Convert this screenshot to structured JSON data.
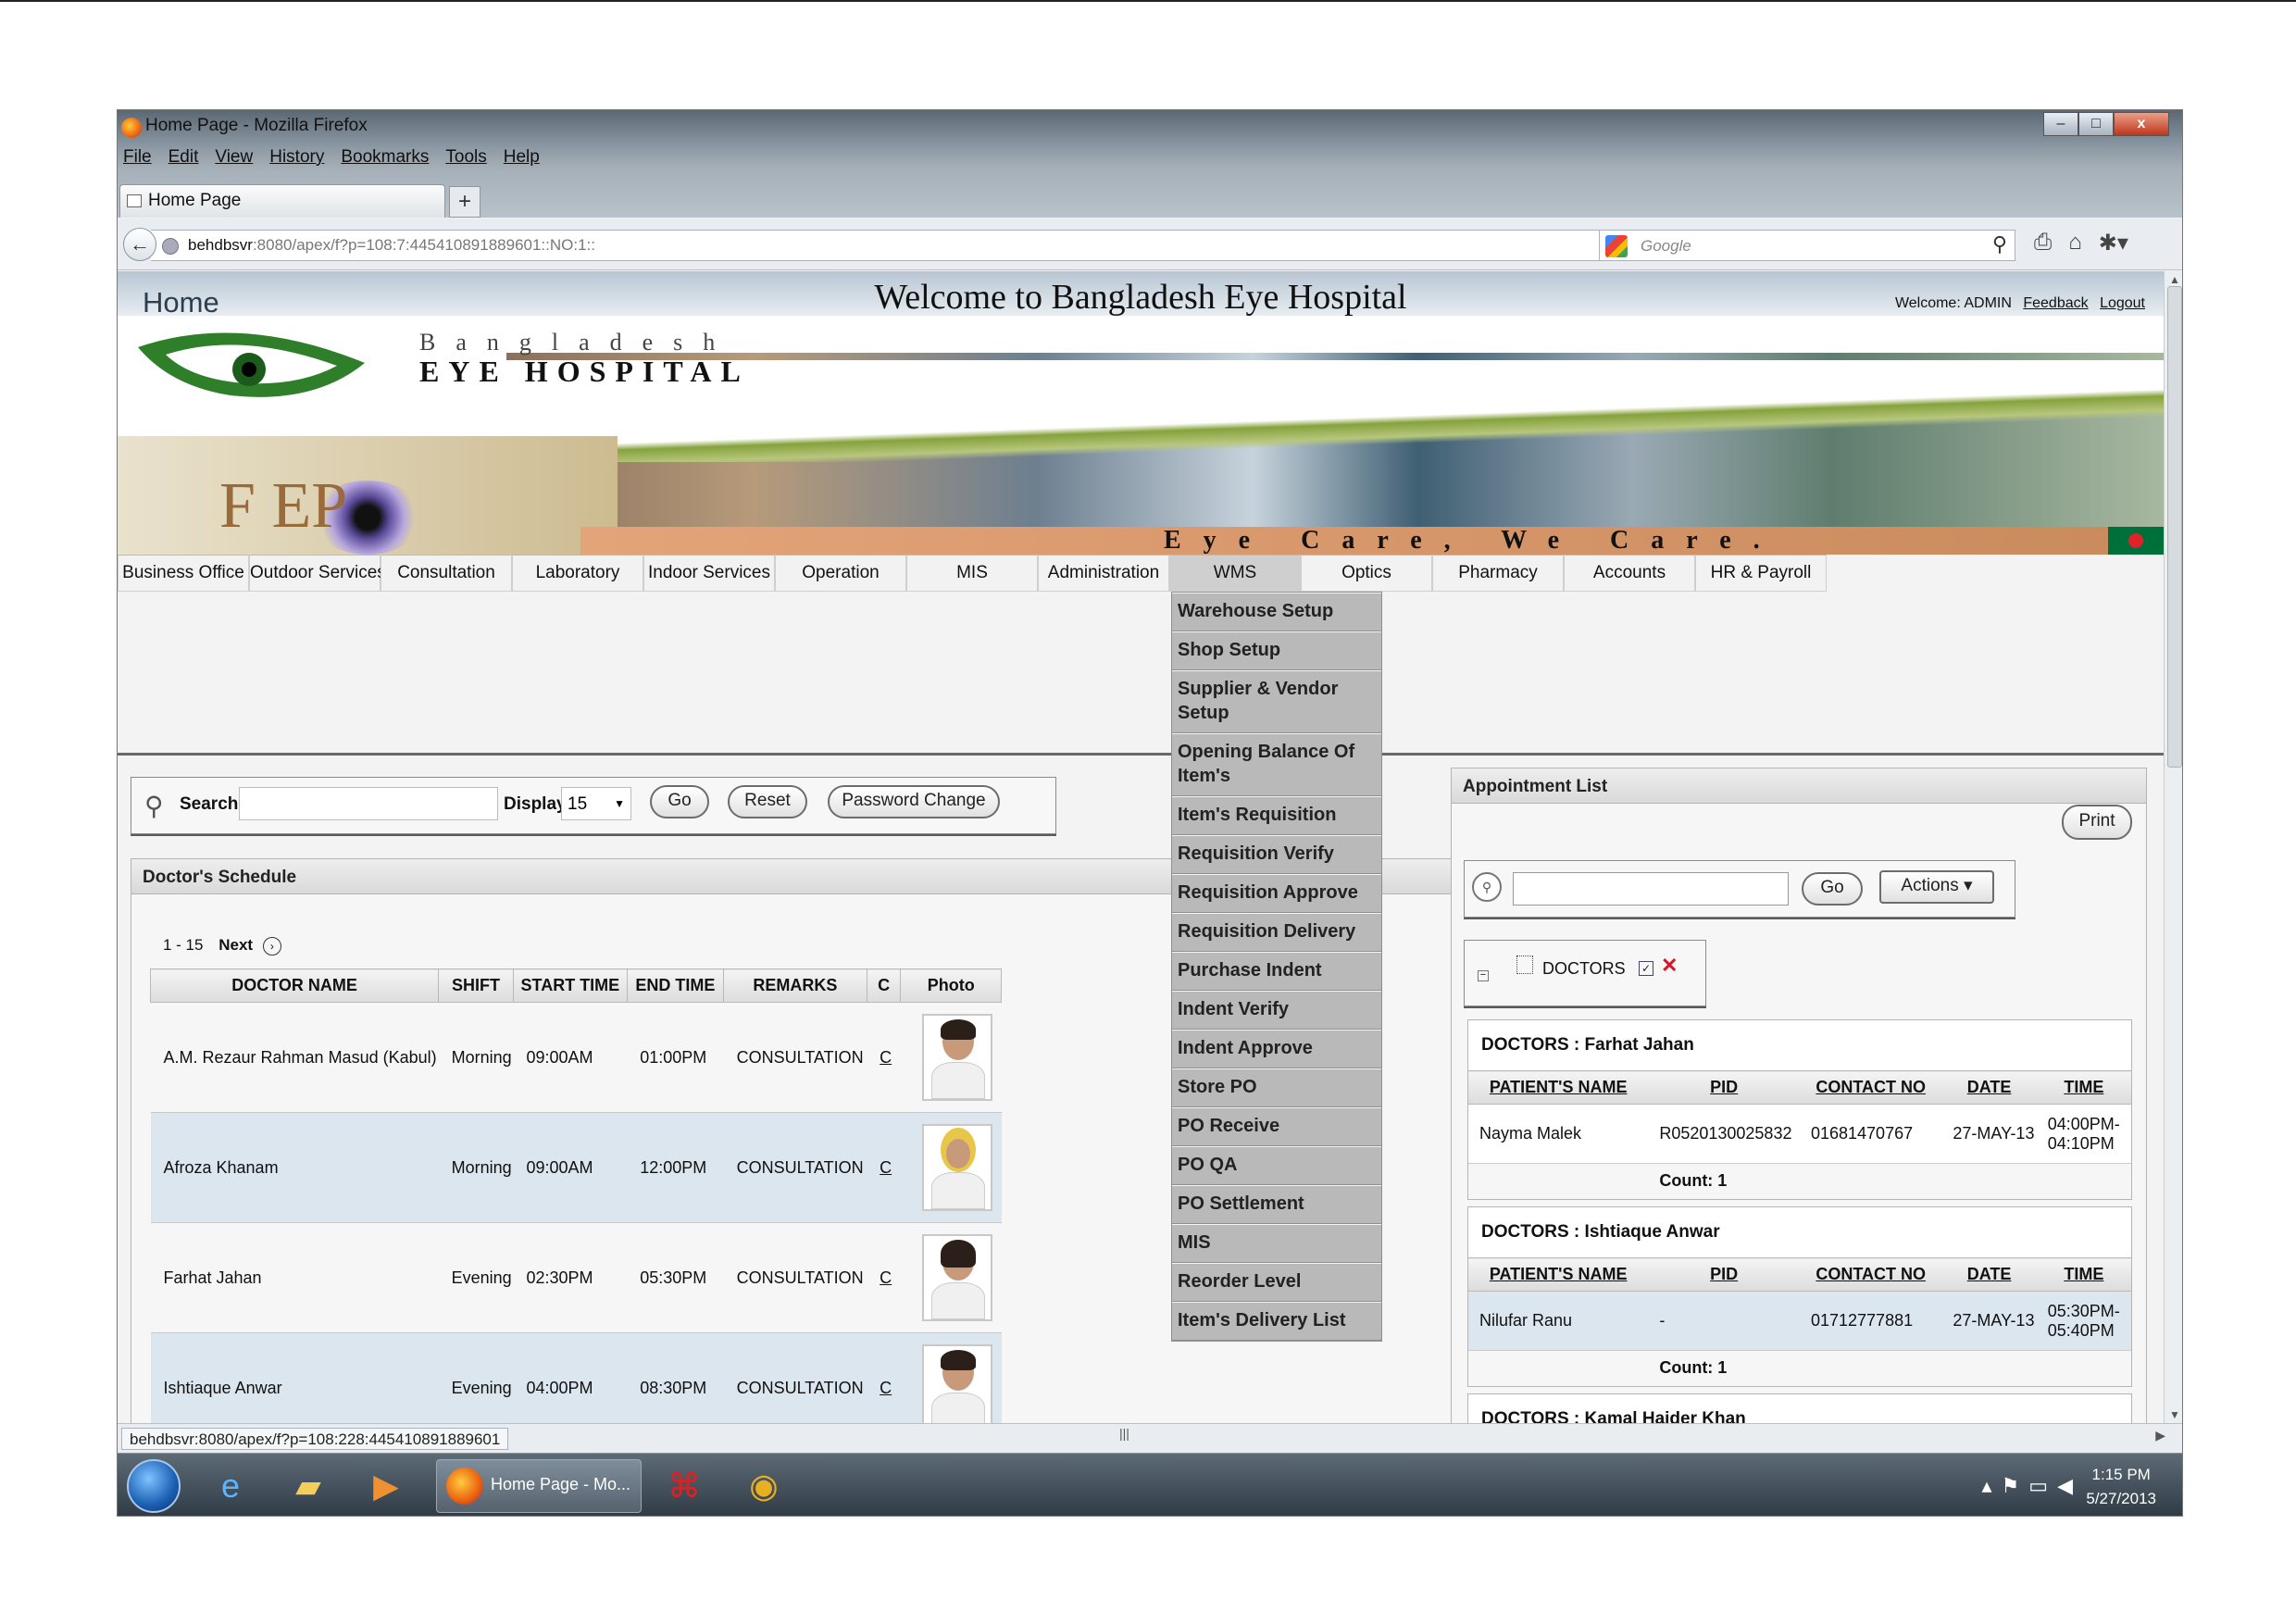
{
  "window": {
    "title": "Home Page - Mozilla Firefox",
    "controls": {
      "minimize": "–",
      "maximize": "□",
      "close": "x"
    }
  },
  "menu": [
    "File",
    "Edit",
    "View",
    "History",
    "Bookmarks",
    "Tools",
    "Help"
  ],
  "tab": {
    "label": "Home Page",
    "new_tab": "+"
  },
  "address": {
    "host": "behdbsvr",
    "path": ":8080/apex/f?p=108:7:445410891889601::NO:1::"
  },
  "search_engine": {
    "placeholder": "Google"
  },
  "page": {
    "heading": "Home",
    "welcome": "Welcome to Bangladesh Eye Hospital",
    "welcome_user": "Welcome: ADMIN",
    "feedback": "Feedback",
    "logout": "Logout"
  },
  "banner": {
    "line1": "Bangladesh",
    "line2": "EYE HOSPITAL",
    "tagline": "Eye Care, We Care.",
    "mark": "EP",
    "mark_f": "F"
  },
  "nav": [
    {
      "label": "Business Office"
    },
    {
      "label": "Outdoor Services"
    },
    {
      "label": "Consultation"
    },
    {
      "label": "Laboratory"
    },
    {
      "label": "Indoor Services"
    },
    {
      "label": "Operation"
    },
    {
      "label": "MIS"
    },
    {
      "label": "Administration"
    },
    {
      "label": "WMS",
      "active": true
    },
    {
      "label": "Optics"
    },
    {
      "label": "Pharmacy"
    },
    {
      "label": "Accounts"
    },
    {
      "label": "HR & Payroll"
    }
  ],
  "wms_menu": [
    "Warehouse Setup",
    "Shop Setup",
    "Supplier & Vendor Setup",
    "Opening Balance Of Item's",
    "Item's Requisition",
    "Requisition Verify",
    "Requisition Approve",
    "Requisition Delivery",
    "Purchase Indent",
    "Indent Verify",
    "Indent Approve",
    "Store PO",
    "PO Receive",
    "PO QA",
    "PO Settlement",
    "MIS",
    "Reorder Level",
    "Item's Delivery List"
  ],
  "search": {
    "label": "Search",
    "value": "",
    "display_label": "Display",
    "display_value": "15",
    "go": "Go",
    "reset": "Reset",
    "password_change": "Password Change"
  },
  "schedule": {
    "title": "Doctor's Schedule",
    "pager_range": "1 - 15",
    "pager_next": "Next",
    "columns": [
      "DOCTOR NAME",
      "SHIFT",
      "START TIME",
      "END TIME",
      "REMARKS",
      "C",
      "Photo"
    ],
    "rows": [
      {
        "name": "A.M. Rezaur Rahman Masud (Kabul)",
        "shift": "Morning",
        "start": "09:00AM",
        "end": "01:00PM",
        "remarks": "CONSULTATION",
        "c": "C"
      },
      {
        "name": "Afroza Khanam",
        "shift": "Morning",
        "start": "09:00AM",
        "end": "12:00PM",
        "remarks": "CONSULTATION",
        "c": "C"
      },
      {
        "name": "Farhat Jahan",
        "shift": "Evening",
        "start": "02:30PM",
        "end": "05:30PM",
        "remarks": "CONSULTATION",
        "c": "C"
      },
      {
        "name": "Ishtiaque Anwar",
        "shift": "Evening",
        "start": "04:00PM",
        "end": "08:30PM",
        "remarks": "CONSULTATION",
        "c": "C"
      }
    ]
  },
  "appointments": {
    "title": "Appointment List",
    "print": "Print",
    "go": "Go",
    "actions": "Actions",
    "filter": "DOCTORS",
    "columns": [
      "PATIENT'S NAME",
      "PID",
      "CONTACT NO",
      "DATE",
      "TIME"
    ],
    "groups": [
      {
        "doctor": "DOCTORS : Farhat Jahan",
        "rows": [
          {
            "patient": "Nayma Malek",
            "pid": "R0520130025832",
            "contact": "01681470767",
            "date": "27-MAY-13",
            "time": "04:00PM-04:10PM"
          }
        ],
        "count": "Count: 1"
      },
      {
        "doctor": "DOCTORS : Ishtiaque Anwar",
        "rows": [
          {
            "patient": "Nilufar Ranu",
            "pid": "-",
            "contact": "01712777881",
            "date": "27-MAY-13",
            "time": "05:30PM-05:40PM"
          }
        ],
        "count": "Count: 1"
      },
      {
        "doctor": "DOCTORS : Kamal Haider Khan",
        "rows": [],
        "count": ""
      }
    ]
  },
  "status_url": "behdbsvr:8080/apex/f?p=108:228:445410891889601",
  "taskbar": {
    "task_label": "Home Page - Mo...",
    "time": "1:15 PM",
    "date": "5/27/2013"
  },
  "colors": {
    "row_alt": "#dce6ef",
    "nav_active": "#cfcfcf",
    "dropdown_bg": "#b9b9b9"
  }
}
